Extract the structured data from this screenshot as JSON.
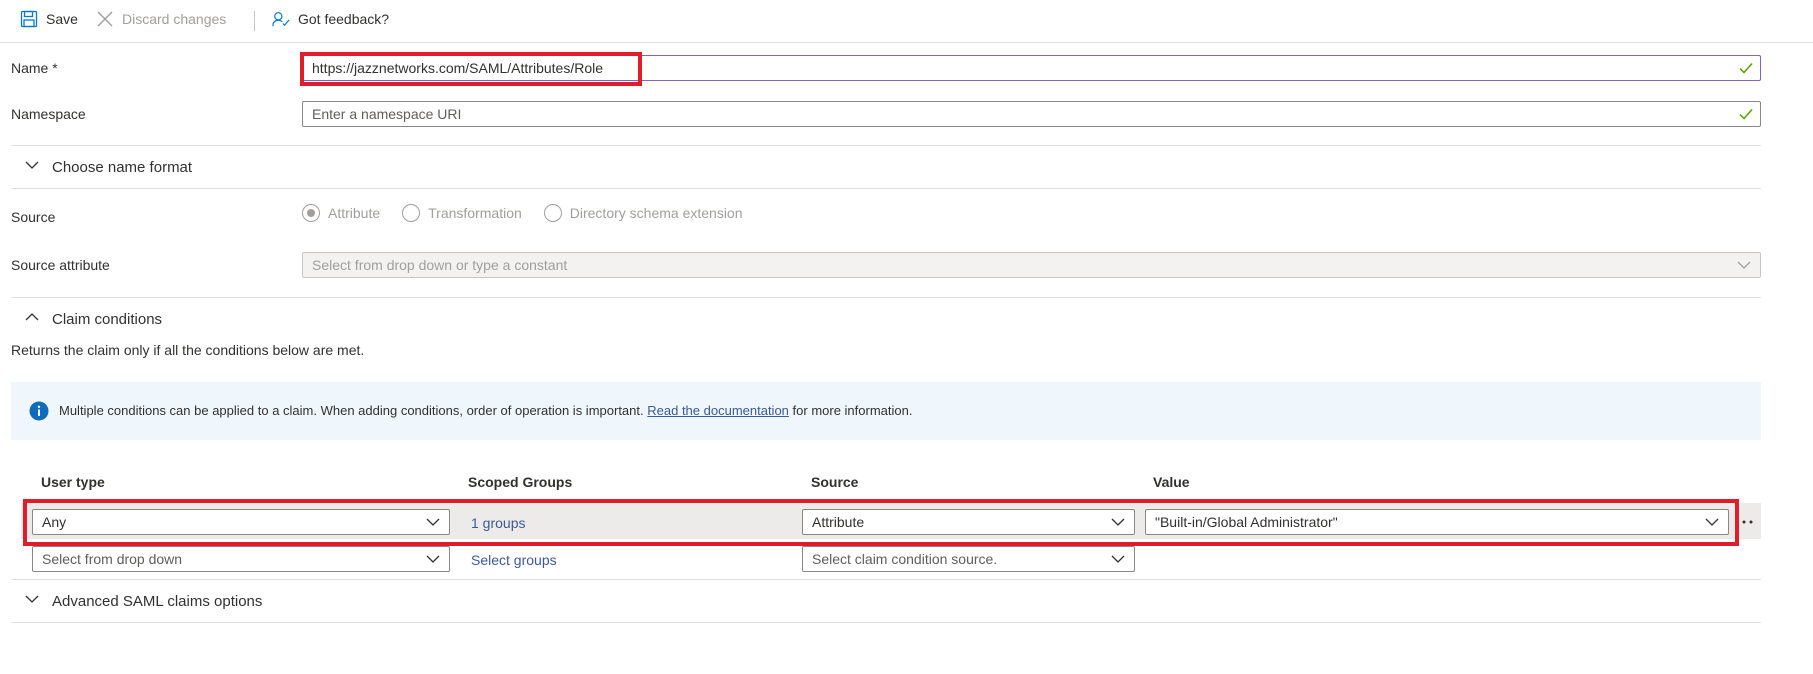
{
  "toolbar": {
    "save_label": "Save",
    "discard_label": "Discard changes",
    "feedback_label": "Got feedback?"
  },
  "form": {
    "name_label": "Name *",
    "name_value": "https://jazznetworks.com/SAML/Attributes/Role",
    "namespace_label": "Namespace",
    "namespace_placeholder": "Enter a namespace URI",
    "name_format_label": "Choose name format",
    "source_label": "Source",
    "source_options": [
      "Attribute",
      "Transformation",
      "Directory schema extension"
    ],
    "source_selected": "Attribute",
    "source_attribute_label": "Source attribute",
    "source_attribute_placeholder": "Select from drop down or type a constant"
  },
  "claim_conditions": {
    "title": "Claim conditions",
    "description": "Returns the claim only if all the conditions below are met.",
    "info_text": "Multiple conditions can be applied to a claim.  When adding conditions, order of operation is important.",
    "info_link": "Read the documentation",
    "info_suffix": "for more information.",
    "columns": [
      "User type",
      "Scoped Groups",
      "Source",
      "Value"
    ],
    "rows": [
      {
        "user_type": "Any",
        "scoped_groups": "1 groups",
        "source": "Attribute",
        "value": "\"Built-in/Global Administrator\""
      }
    ],
    "new_row": {
      "user_type_placeholder": "Select from drop down",
      "groups_link": "Select groups",
      "source_placeholder": "Select claim condition source."
    }
  },
  "advanced": {
    "title": "Advanced SAML claims options"
  },
  "colors": {
    "accent": "#0078d4",
    "link": "#3c5a99",
    "highlight": "#e11d2b",
    "valid_check": "#57a300",
    "info_bg": "#eff6fc"
  }
}
